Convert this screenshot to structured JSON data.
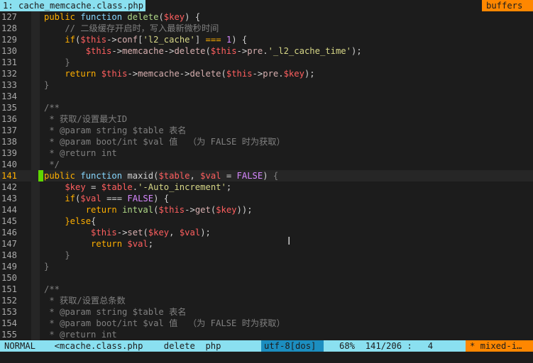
{
  "tabline": {
    "active_tab": "1: cache_memcache.class.php",
    "buffers_label": "buffers"
  },
  "editor": {
    "current_line": "141",
    "lines": [
      {
        "no": "127",
        "tokens": [
          [
            "kw",
            "public "
          ],
          [
            "fn",
            "function "
          ],
          [
            "fnn",
            "delete"
          ],
          [
            "pun",
            "("
          ],
          [
            "var",
            "$key"
          ],
          [
            "pun",
            ") {"
          ]
        ]
      },
      {
        "no": "128",
        "tokens": [
          [
            "cmt",
            "    // 二级缓存开启时，写入最新微秒时间"
          ]
        ]
      },
      {
        "no": "129",
        "tokens": [
          [
            "kw",
            "    if"
          ],
          [
            "pun",
            "("
          ],
          [
            "var",
            "$this"
          ],
          [
            "pun",
            "->"
          ],
          [
            "mth",
            "conf"
          ],
          [
            "pun",
            "["
          ],
          [
            "str",
            "'l2_cache'"
          ],
          [
            "pun",
            "] "
          ],
          [
            "kw",
            "==="
          ],
          [
            "num",
            " 1"
          ],
          [
            "pun",
            ") {"
          ]
        ]
      },
      {
        "no": "130",
        "tokens": [
          [
            "var",
            "        $this"
          ],
          [
            "pun",
            "->"
          ],
          [
            "mth",
            "memcache"
          ],
          [
            "pun",
            "->"
          ],
          [
            "mth",
            "delete"
          ],
          [
            "pun",
            "("
          ],
          [
            "var",
            "$this"
          ],
          [
            "pun",
            "->"
          ],
          [
            "mth",
            "pre"
          ],
          [
            "pun",
            "."
          ],
          [
            "str",
            "'_l2_cache_time'"
          ],
          [
            "pun",
            ");"
          ]
        ]
      },
      {
        "no": "131",
        "tokens": [
          [
            "dim",
            "    }"
          ]
        ]
      },
      {
        "no": "132",
        "tokens": [
          [
            "kw",
            "    return "
          ],
          [
            "var",
            "$this"
          ],
          [
            "pun",
            "->"
          ],
          [
            "mth",
            "memcache"
          ],
          [
            "pun",
            "->"
          ],
          [
            "mth",
            "delete"
          ],
          [
            "pun",
            "("
          ],
          [
            "var",
            "$this"
          ],
          [
            "pun",
            "->"
          ],
          [
            "mth",
            "pre"
          ],
          [
            "pun",
            "."
          ],
          [
            "var",
            "$key"
          ],
          [
            "pun",
            ");"
          ]
        ]
      },
      {
        "no": "133",
        "tokens": [
          [
            "dim",
            "}"
          ]
        ]
      },
      {
        "no": "134",
        "tokens": []
      },
      {
        "no": "135",
        "tokens": [
          [
            "cmt",
            "/**"
          ]
        ]
      },
      {
        "no": "136",
        "tokens": [
          [
            "cmt",
            " * 获取/设置最大ID"
          ]
        ]
      },
      {
        "no": "137",
        "tokens": [
          [
            "cmt",
            " * @param string $table 表名"
          ]
        ]
      },
      {
        "no": "138",
        "tokens": [
          [
            "cmt",
            " * @param boot/int $val 值  （为 FALSE 时为获取）"
          ]
        ]
      },
      {
        "no": "139",
        "tokens": [
          [
            "cmt",
            " * @return int"
          ]
        ]
      },
      {
        "no": "140",
        "tokens": [
          [
            "cmt",
            " */"
          ]
        ]
      },
      {
        "no": "141",
        "tokens": [
          [
            "kw",
            "public "
          ],
          [
            "fn",
            "function "
          ],
          [
            "pun",
            "maxid("
          ],
          [
            "var",
            "$table"
          ],
          [
            "pun",
            ", "
          ],
          [
            "var",
            "$val"
          ],
          [
            "pun",
            " = "
          ],
          [
            "bool",
            "FALSE"
          ],
          [
            "pun",
            ") "
          ],
          [
            "dim",
            "{"
          ]
        ]
      },
      {
        "no": "142",
        "tokens": [
          [
            "var",
            "    $key"
          ],
          [
            "pun",
            " = "
          ],
          [
            "var",
            "$table"
          ],
          [
            "pun",
            "."
          ],
          [
            "str",
            "'-Auto_increment'"
          ],
          [
            "pun",
            ";"
          ]
        ]
      },
      {
        "no": "143",
        "tokens": [
          [
            "kw",
            "    if"
          ],
          [
            "pun",
            "("
          ],
          [
            "var",
            "$val"
          ],
          [
            "pun",
            " === "
          ],
          [
            "bool",
            "FALSE"
          ],
          [
            "pun",
            ") {"
          ]
        ]
      },
      {
        "no": "144",
        "tokens": [
          [
            "kw",
            "        return "
          ],
          [
            "fnn",
            "intval"
          ],
          [
            "pun",
            "("
          ],
          [
            "var",
            "$this"
          ],
          [
            "pun",
            "->"
          ],
          [
            "mth",
            "get"
          ],
          [
            "pun",
            "("
          ],
          [
            "var",
            "$key"
          ],
          [
            "pun",
            "));"
          ]
        ]
      },
      {
        "no": "145",
        "tokens": [
          [
            "kw",
            "    }else"
          ],
          [
            "pun",
            "{"
          ]
        ]
      },
      {
        "no": "146",
        "tokens": [
          [
            "var",
            "         $this"
          ],
          [
            "pun",
            "->"
          ],
          [
            "mth",
            "set"
          ],
          [
            "pun",
            "("
          ],
          [
            "var",
            "$key"
          ],
          [
            "pun",
            ", "
          ],
          [
            "var",
            "$val"
          ],
          [
            "pun",
            ");"
          ]
        ]
      },
      {
        "no": "147",
        "tokens": [
          [
            "kw",
            "         return "
          ],
          [
            "var",
            "$val"
          ],
          [
            "pun",
            ";"
          ]
        ]
      },
      {
        "no": "148",
        "tokens": [
          [
            "dim",
            "    }"
          ]
        ]
      },
      {
        "no": "149",
        "tokens": [
          [
            "dim",
            "}"
          ]
        ]
      },
      {
        "no": "150",
        "tokens": []
      },
      {
        "no": "151",
        "tokens": [
          [
            "cmt",
            "/**"
          ]
        ]
      },
      {
        "no": "152",
        "tokens": [
          [
            "cmt",
            " * 获取/设置总条数"
          ]
        ]
      },
      {
        "no": "153",
        "tokens": [
          [
            "cmt",
            " * @param string $table 表名"
          ]
        ]
      },
      {
        "no": "154",
        "tokens": [
          [
            "cmt",
            " * @param boot/int $val 值  （为 FALSE 时为获取）"
          ]
        ]
      },
      {
        "no": "155",
        "tokens": [
          [
            "cmt",
            " * @return int"
          ]
        ]
      }
    ]
  },
  "statusline": {
    "mode": "NORMAL",
    "file": "  <mcache.class.php    delete  php ",
    "encoding": "utf-8[dos]",
    "position": "   68%  141/206 :   4 ",
    "warning": "* mixed-i…"
  },
  "colors": {
    "background": "#1c1c1c",
    "tab_active": "#8ae0f0",
    "buffers": "#ff8700",
    "keyword": "#ffaf00",
    "variable": "#ff5f5f",
    "string": "#d7d787",
    "comment": "#808080",
    "sign_marker": "#5fd700"
  }
}
